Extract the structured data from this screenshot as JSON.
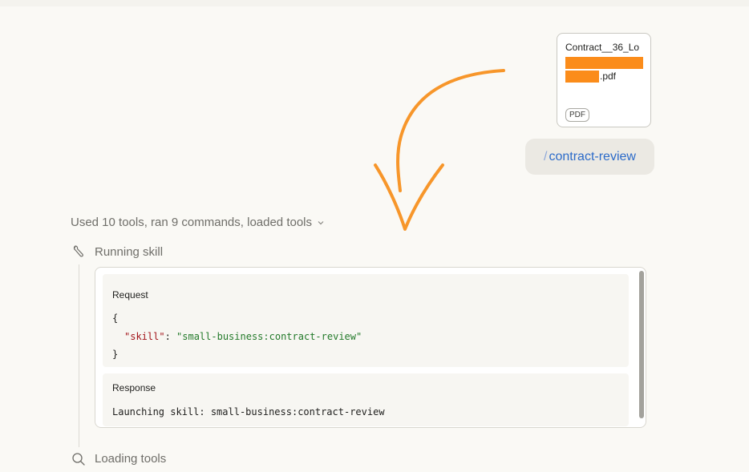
{
  "attachment": {
    "name_line1": "Contract__36_Lo",
    "extension": ".pdf",
    "badge": "PDF"
  },
  "command": {
    "slash": "/",
    "name": "contract-review"
  },
  "tools": {
    "summary": "Used 10 tools, ran 9 commands, loaded tools",
    "running_label": "Running skill",
    "loading_label": "Loading tools",
    "request_title": "Request",
    "request_open": "{",
    "request_key": "\"skill\"",
    "request_colon": ": ",
    "request_value": "\"small-business:contract-review\"",
    "request_close": "}",
    "response_title": "Response",
    "response_text": "Launching skill: small-business:contract-review"
  },
  "colors": {
    "redaction": "#fb8c1a",
    "annotation_arrow": "#f7962a",
    "command_text": "#2c6bc9"
  },
  "icons": [
    "wrench-icon",
    "search-icon",
    "chevron-down-icon"
  ]
}
